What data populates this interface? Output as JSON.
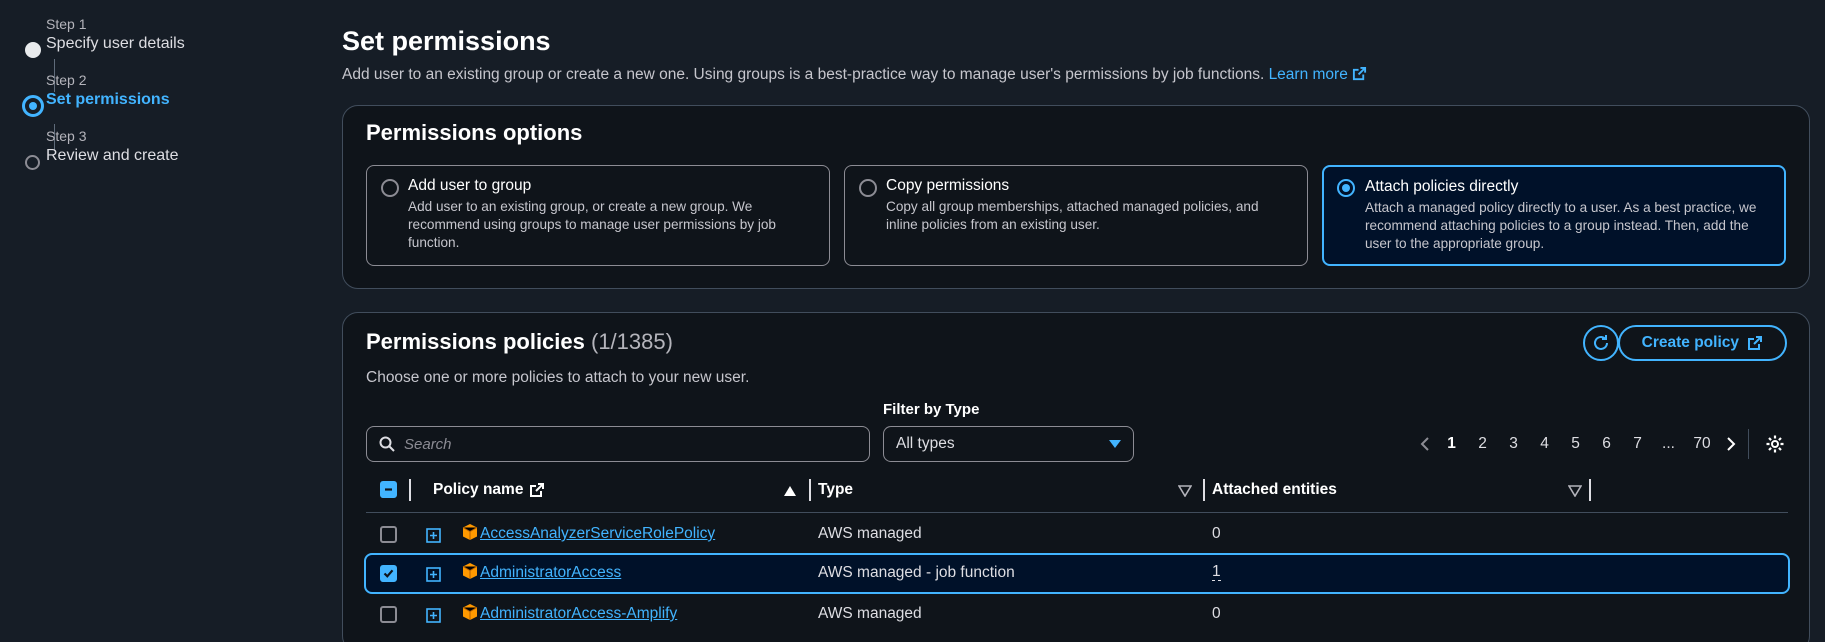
{
  "steps": [
    {
      "num": "Step 1",
      "label": "Specify user details",
      "state": "done"
    },
    {
      "num": "Step 2",
      "label": "Set permissions",
      "state": "current"
    },
    {
      "num": "Step 3",
      "label": "Review and create",
      "state": "pending"
    }
  ],
  "page": {
    "title": "Set permissions",
    "description": "Add user to an existing group or create a new one. Using groups is a best-practice way to manage user's permissions by job functions.",
    "learn_more": "Learn more"
  },
  "options": {
    "title": "Permissions options",
    "tiles": [
      {
        "title": "Add user to group",
        "desc": "Add user to an existing group, or create a new group. We recommend using groups to manage user permissions by job function.",
        "selected": false
      },
      {
        "title": "Copy permissions",
        "desc": "Copy all group memberships, attached managed policies, and inline policies from an existing user.",
        "selected": false
      },
      {
        "title": "Attach policies directly",
        "desc": "Attach a managed policy directly to a user. As a best practice, we recommend attaching policies to a group instead. Then, add the user to the appropriate group.",
        "selected": true
      }
    ]
  },
  "policies": {
    "title": "Permissions policies",
    "count": "(1/1385)",
    "description": "Choose one or more policies to attach to your new user.",
    "create_label": "Create policy",
    "filter_label": "Filter by Type",
    "search_placeholder": "Search",
    "filter_value": "All types",
    "pages": [
      "1",
      "2",
      "3",
      "4",
      "5",
      "6",
      "7",
      "...",
      "70"
    ],
    "current_page": "1",
    "columns": {
      "name": "Policy name",
      "type": "Type",
      "entities": "Attached entities"
    },
    "rows": [
      {
        "name": "AccessAnalyzerServiceRolePolicy",
        "type": "AWS managed",
        "entities": "0",
        "checked": false
      },
      {
        "name": "AdministratorAccess",
        "type": "AWS managed - job function",
        "entities": "1",
        "checked": true
      },
      {
        "name": "AdministratorAccess-Amplify",
        "type": "AWS managed",
        "entities": "0",
        "checked": false
      }
    ]
  },
  "colors": {
    "accent": "#42b4ff",
    "background": "#161d26",
    "card": "#0f141a",
    "package": "#ff9900"
  }
}
